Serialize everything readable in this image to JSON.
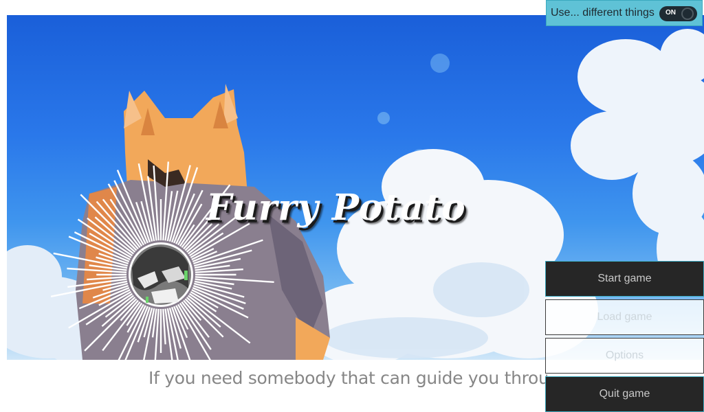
{
  "title": {
    "text": "Furry Potato"
  },
  "subtitle": {
    "text": "If you need somebody that can guide you through"
  },
  "toggle": {
    "label": "Use... different things",
    "state": "ON"
  },
  "menu": {
    "start_label": "Start game",
    "load_label": "Load game",
    "options_label": "Options",
    "quit_label": "Quit game"
  },
  "colors": {
    "accent": "#5fc2d6",
    "button_dark": "#262626",
    "sky": "#2a78ea",
    "fox_fur": "#f2a85a"
  }
}
